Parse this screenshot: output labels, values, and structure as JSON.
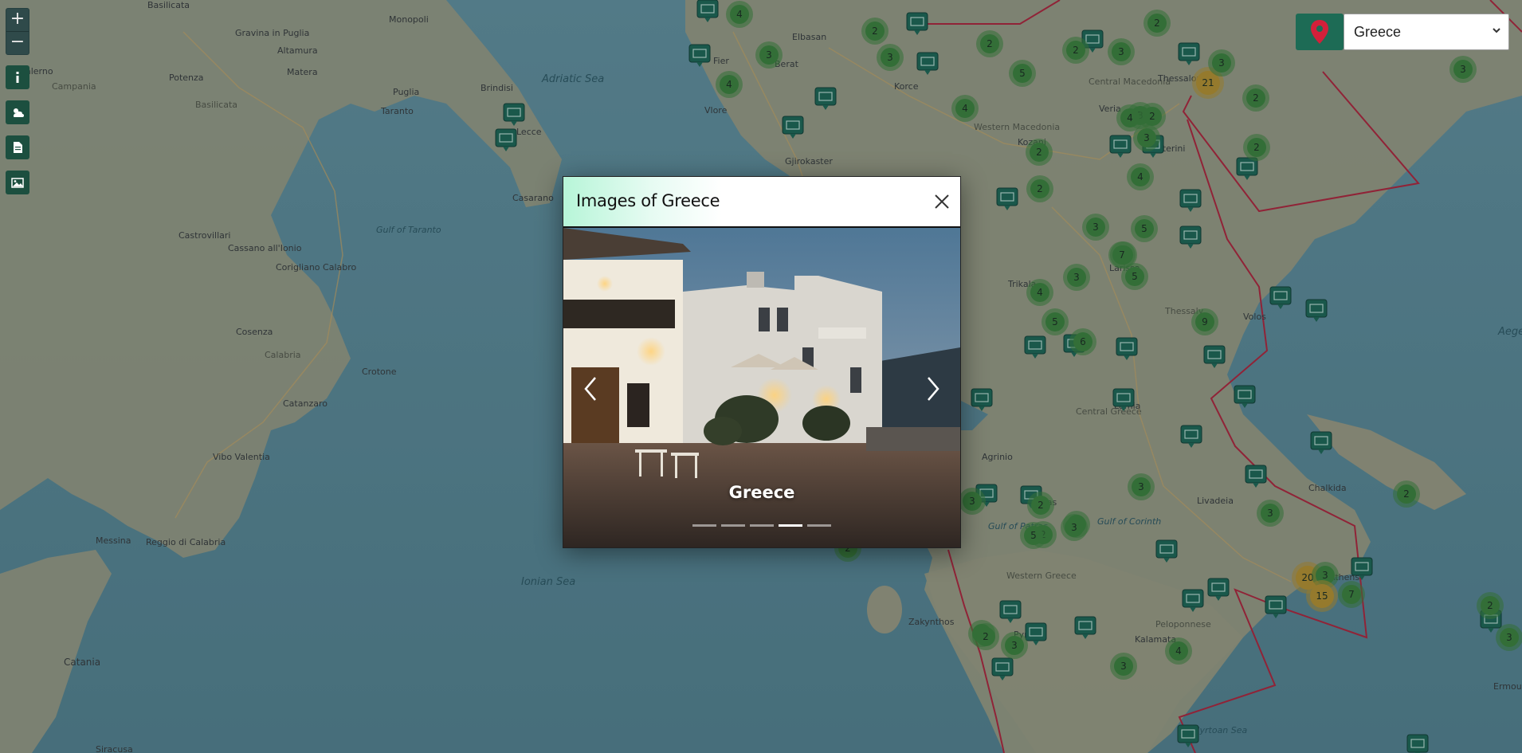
{
  "map": {
    "labels": [
      {
        "text": "Basilicata"
      },
      {
        "text": "Gravina in Puglia"
      },
      {
        "text": "Monopoli"
      },
      {
        "text": "Altamura"
      },
      {
        "text": "Potenza"
      },
      {
        "text": "Matera"
      },
      {
        "text": "Puglia"
      },
      {
        "text": "Brindisi"
      },
      {
        "text": "Adriatic Sea"
      },
      {
        "text": "Taranto"
      },
      {
        "text": "Lecce"
      },
      {
        "text": "Basilicata"
      },
      {
        "text": "Campania"
      },
      {
        "text": "Salerno"
      },
      {
        "text": "Casarano"
      },
      {
        "text": "Castrovillari"
      },
      {
        "text": "Cassano all'Ionio"
      },
      {
        "text": "Corigliano Calabro"
      },
      {
        "text": "Gulf of Taranto"
      },
      {
        "text": "Cosenza"
      },
      {
        "text": "Calabria"
      },
      {
        "text": "Crotone"
      },
      {
        "text": "Catanzaro"
      },
      {
        "text": "Vibo Valentia"
      },
      {
        "text": "Messina"
      },
      {
        "text": "Reggio di Calabria"
      },
      {
        "text": "Catania"
      },
      {
        "text": "Siracusa"
      },
      {
        "text": "Ionian Sea"
      },
      {
        "text": "Vlore"
      },
      {
        "text": "Berat"
      },
      {
        "text": "Elbasan"
      },
      {
        "text": "Korce"
      },
      {
        "text": "Gjirokaster"
      },
      {
        "text": "Fier"
      },
      {
        "text": "Kozani"
      },
      {
        "text": "Western Macedonia"
      },
      {
        "text": "Central Macedonia"
      },
      {
        "text": "Thessaloniki"
      },
      {
        "text": "Veria"
      },
      {
        "text": "Katerini"
      },
      {
        "text": "Larissa"
      },
      {
        "text": "Trikala"
      },
      {
        "text": "Thessaly"
      },
      {
        "text": "Volos"
      },
      {
        "text": "Lamia"
      },
      {
        "text": "Central Greece"
      },
      {
        "text": "Agrinio"
      },
      {
        "text": "Gulf of Patras"
      },
      {
        "text": "Gulf of Corinth"
      },
      {
        "text": "Patras"
      },
      {
        "text": "Western Greece"
      },
      {
        "text": "Livadeia"
      },
      {
        "text": "Chalkida"
      },
      {
        "text": "Athens"
      },
      {
        "text": "Peloponnese"
      },
      {
        "text": "Zakynthos"
      },
      {
        "text": "Myrtoan Sea"
      },
      {
        "text": "Aegean"
      },
      {
        "text": "Ermoupoli"
      },
      {
        "text": "Pyrgos"
      },
      {
        "text": "Kalamata"
      }
    ],
    "clusters": [
      {
        "count": "4"
      },
      {
        "count": "3"
      },
      {
        "count": "4"
      },
      {
        "count": "2"
      },
      {
        "count": "3"
      },
      {
        "count": "2"
      },
      {
        "count": "5"
      },
      {
        "count": "2"
      },
      {
        "count": "3"
      },
      {
        "count": "2"
      },
      {
        "count": "4"
      },
      {
        "count": "3"
      },
      {
        "count": "21"
      },
      {
        "count": "3"
      },
      {
        "count": "4"
      },
      {
        "count": "2"
      },
      {
        "count": "3"
      },
      {
        "count": "2"
      },
      {
        "count": "4"
      },
      {
        "count": "2"
      },
      {
        "count": "2"
      },
      {
        "count": "3"
      },
      {
        "count": "5"
      },
      {
        "count": "2"
      },
      {
        "count": "7"
      },
      {
        "count": "5"
      },
      {
        "count": "3"
      },
      {
        "count": "4"
      },
      {
        "count": "5"
      },
      {
        "count": "6"
      },
      {
        "count": "9"
      },
      {
        "count": "3"
      },
      {
        "count": "3"
      },
      {
        "count": "2"
      },
      {
        "count": "3"
      },
      {
        "count": "2"
      },
      {
        "count": "2"
      },
      {
        "count": "5"
      },
      {
        "count": "3"
      },
      {
        "count": "20"
      },
      {
        "count": "3"
      },
      {
        "count": "15"
      },
      {
        "count": "7"
      },
      {
        "count": "2"
      },
      {
        "count": "3"
      },
      {
        "count": "4"
      },
      {
        "count": "3"
      },
      {
        "count": "2"
      },
      {
        "count": "3"
      },
      {
        "count": "2"
      },
      {
        "count": "3"
      },
      {
        "count": "2"
      },
      {
        "count": "3"
      },
      {
        "count": "2"
      }
    ]
  },
  "controls": {
    "zoom_in": "+",
    "zoom_out": "−"
  },
  "country_select": {
    "value": "Greece",
    "options": [
      "Greece"
    ]
  },
  "modal": {
    "title": "Images of Greece",
    "slide_caption": "Greece",
    "slide_count": 5,
    "active_slide_index": 3
  },
  "colors": {
    "accent_green": "#1d6b55",
    "pin_red": "#d3203a",
    "border_red": "#c0223a",
    "cluster_green": "#3f8a3a",
    "cluster_amber": "#c79a2c"
  }
}
